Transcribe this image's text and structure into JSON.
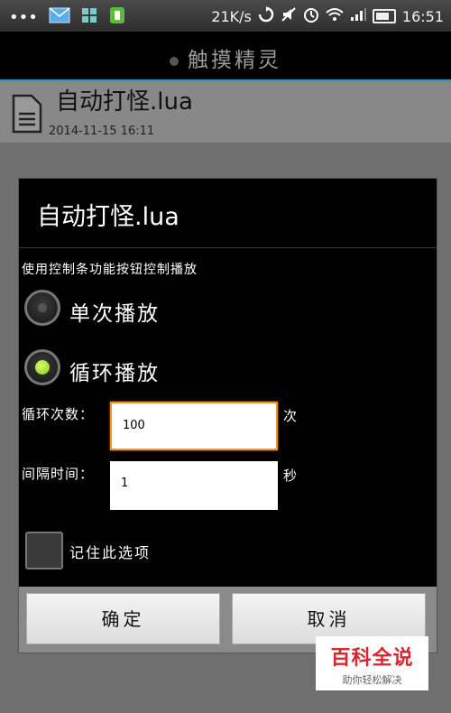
{
  "status_bar": {
    "speed": "21K/s",
    "time": "16:51",
    "dots": "•••"
  },
  "app": {
    "title": "触摸精灵"
  },
  "file": {
    "name": "自动打怪.lua",
    "date": "2014-11-15  16:11"
  },
  "dialog": {
    "title": "自动打怪.lua",
    "hint": "使用控制条功能按钮控制播放",
    "options": [
      {
        "label": "单次播放",
        "selected": false
      },
      {
        "label": "循环播放",
        "selected": true
      }
    ],
    "loop_count": {
      "label": "循环次数：",
      "value": "100",
      "unit": "次"
    },
    "interval": {
      "label": "间隔时间：",
      "value": "1",
      "unit": "秒"
    },
    "remember": {
      "label": "记住此选项",
      "checked": false
    },
    "buttons": {
      "ok": "确定",
      "cancel": "取消"
    }
  },
  "watermark": {
    "brand": "百科全说",
    "slogan": "助你轻松解决"
  }
}
